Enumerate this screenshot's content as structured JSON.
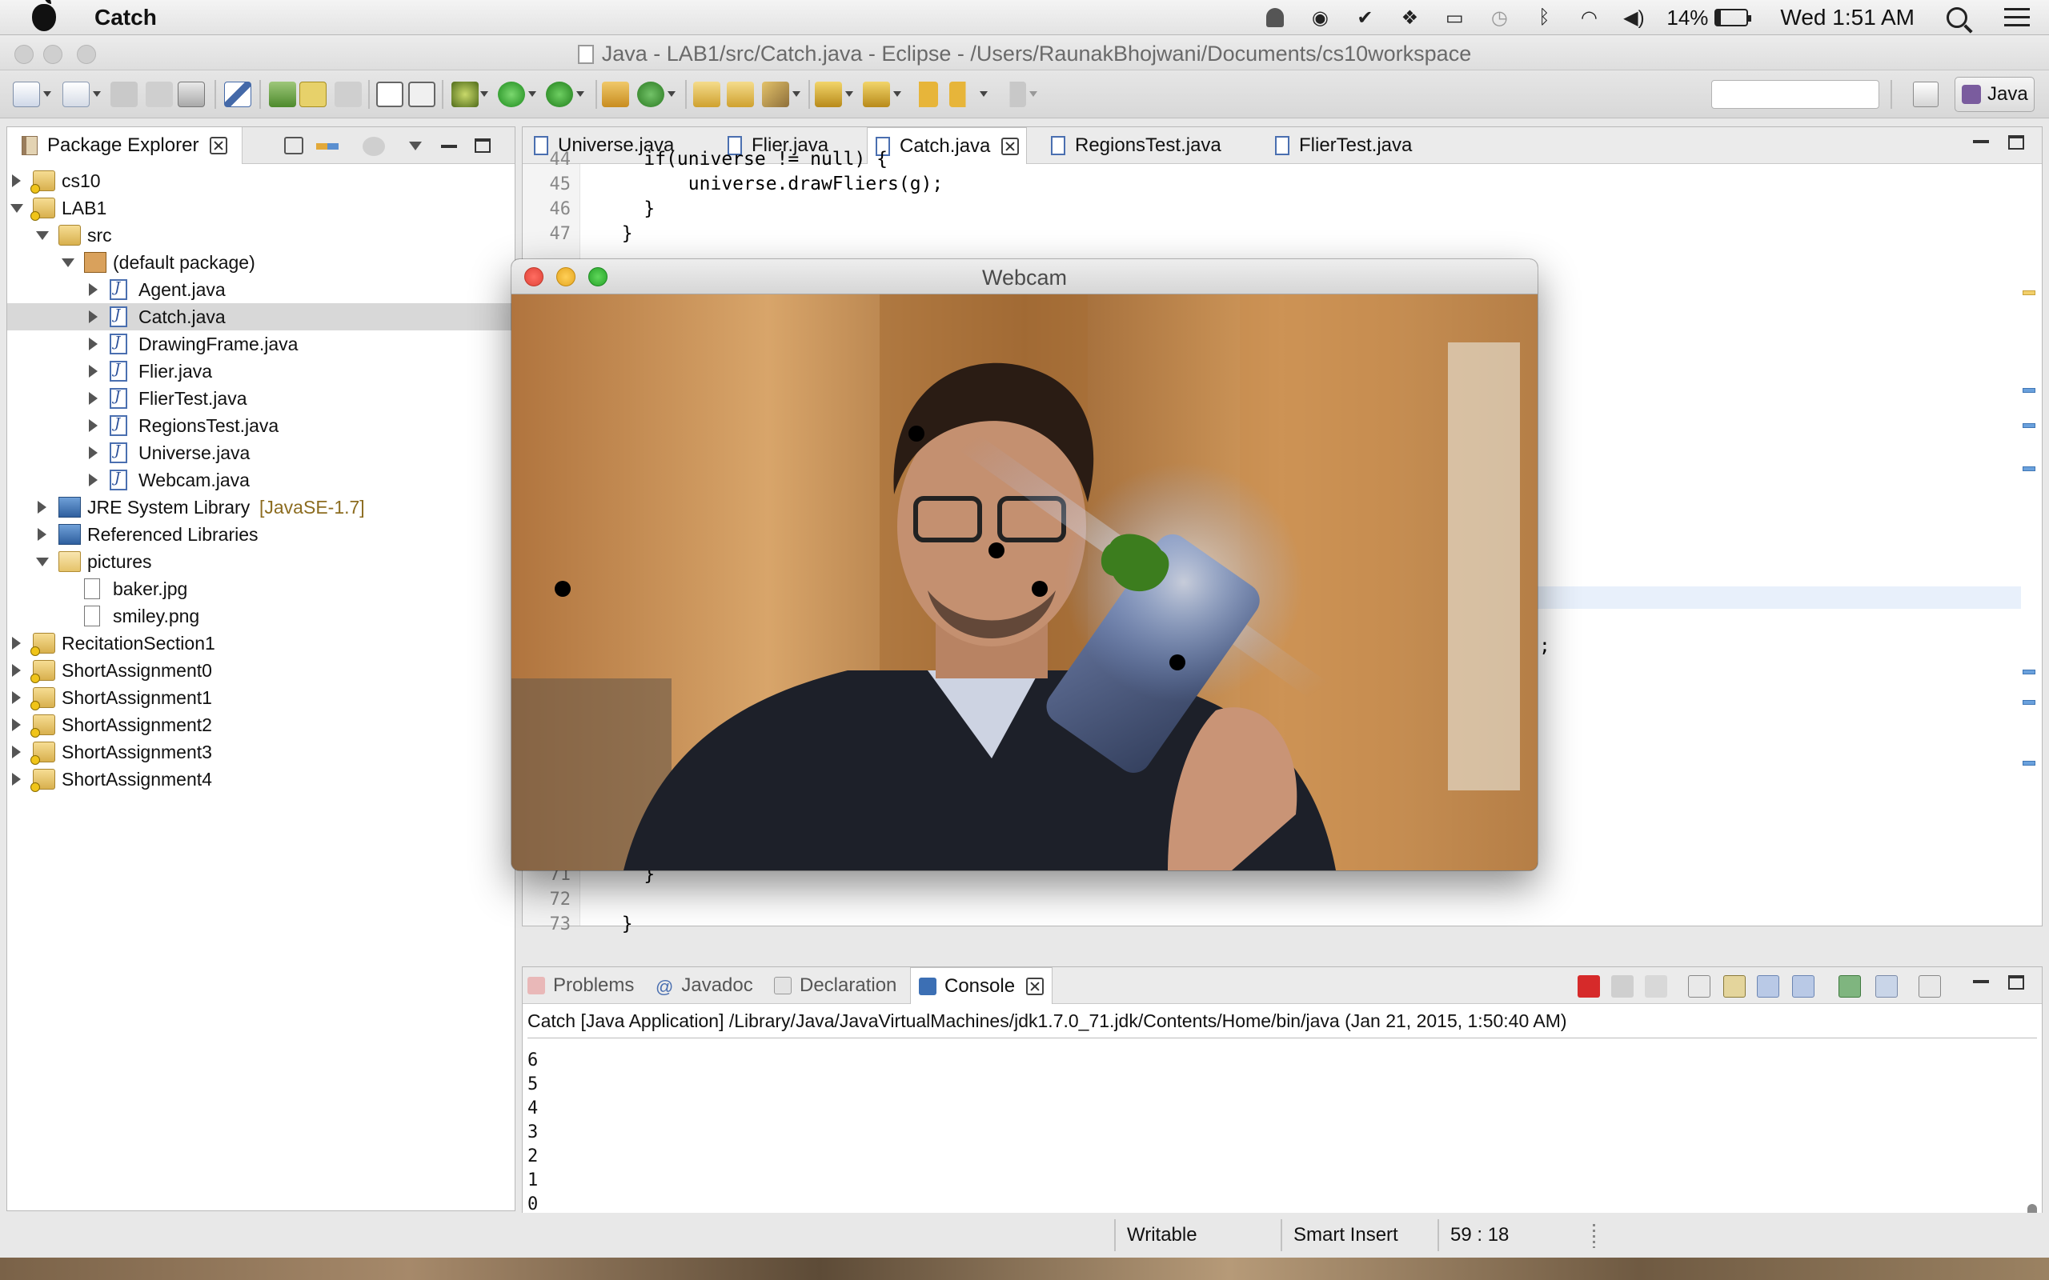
{
  "menubar": {
    "app_name": "Catch",
    "battery_percent": "14%",
    "clock": "Wed 1:51 AM",
    "icons": [
      "notification-icon",
      "user-icon",
      "check-icon",
      "dropbox-icon",
      "airplay-icon",
      "time-machine-icon",
      "bluetooth-icon",
      "wifi-icon",
      "volume-icon",
      "battery-icon",
      "spotlight-icon",
      "notification-center-icon"
    ],
    "battery_level": 0.14
  },
  "window": {
    "title": "Java - LAB1/src/Catch.java - Eclipse - /Users/RaunakBhojwani/Documents/cs10workspace"
  },
  "toolbar": {
    "quick_access_placeholder": "",
    "perspective_label": "Java"
  },
  "package_explorer": {
    "title": "Package Explorer",
    "tree": [
      {
        "label": "cs10",
        "level": 0,
        "expanded": false,
        "icon": "project-icon"
      },
      {
        "label": "LAB1",
        "level": 0,
        "expanded": true,
        "icon": "project-icon"
      },
      {
        "label": "src",
        "level": 1,
        "expanded": true,
        "icon": "source-folder-icon"
      },
      {
        "label": "(default package)",
        "level": 2,
        "expanded": true,
        "icon": "package-icon"
      },
      {
        "label": "Agent.java",
        "level": 3,
        "expanded": false,
        "icon": "java-file-icon"
      },
      {
        "label": "Catch.java",
        "level": 3,
        "expanded": false,
        "icon": "java-file-icon",
        "selected": true
      },
      {
        "label": "DrawingFrame.java",
        "level": 3,
        "expanded": false,
        "icon": "java-file-icon"
      },
      {
        "label": "Flier.java",
        "level": 3,
        "expanded": false,
        "icon": "java-file-icon"
      },
      {
        "label": "FlierTest.java",
        "level": 3,
        "expanded": false,
        "icon": "java-file-icon"
      },
      {
        "label": "RegionsTest.java",
        "level": 3,
        "expanded": false,
        "icon": "java-file-icon"
      },
      {
        "label": "Universe.java",
        "level": 3,
        "expanded": false,
        "icon": "java-file-icon"
      },
      {
        "label": "Webcam.java",
        "level": 3,
        "expanded": false,
        "icon": "java-file-icon"
      },
      {
        "label": "JRE System Library",
        "suffix": "[JavaSE-1.7]",
        "level": 1,
        "expanded": false,
        "icon": "library-icon"
      },
      {
        "label": "Referenced Libraries",
        "level": 1,
        "expanded": false,
        "icon": "library-icon"
      },
      {
        "label": "pictures",
        "level": 1,
        "expanded": true,
        "icon": "folder-icon"
      },
      {
        "label": "baker.jpg",
        "level": 2,
        "icon": "file-icon"
      },
      {
        "label": "smiley.png",
        "level": 2,
        "icon": "file-icon"
      },
      {
        "label": "RecitationSection1",
        "level": 0,
        "expanded": false,
        "icon": "project-icon"
      },
      {
        "label": "ShortAssignment0",
        "level": 0,
        "expanded": false,
        "icon": "project-icon"
      },
      {
        "label": "ShortAssignment1",
        "level": 0,
        "expanded": false,
        "icon": "project-icon"
      },
      {
        "label": "ShortAssignment2",
        "level": 0,
        "expanded": false,
        "icon": "project-icon"
      },
      {
        "label": "ShortAssignment3",
        "level": 0,
        "expanded": false,
        "icon": "project-icon"
      },
      {
        "label": "ShortAssignment4",
        "level": 0,
        "expanded": false,
        "icon": "project-icon"
      }
    ]
  },
  "editor": {
    "tabs": [
      {
        "label": "Universe.java",
        "active": false
      },
      {
        "label": "Flier.java",
        "active": false
      },
      {
        "label": "Catch.java",
        "active": true
      },
      {
        "label": "RegionsTest.java",
        "active": false
      },
      {
        "label": "FlierTest.java",
        "active": false
      }
    ],
    "top_lines": [
      {
        "num": "44",
        "code": "    if(universe != null) {"
      },
      {
        "num": "45",
        "code": "        universe.drawFliers(g);"
      },
      {
        "num": "46",
        "code": "    }"
      },
      {
        "num": "47",
        "code": "  }"
      }
    ],
    "bottom_lines": [
      {
        "num": "71",
        "code": "    }"
      },
      {
        "num": "72",
        "code": ""
      },
      {
        "num": "73",
        "code": "  }"
      }
    ],
    "visible_fragment": ";"
  },
  "webcam": {
    "title": "Webcam"
  },
  "console": {
    "tabs": [
      {
        "label": "Problems",
        "active": false
      },
      {
        "label": "Javadoc",
        "active": false
      },
      {
        "label": "Declaration",
        "active": false
      },
      {
        "label": "Console",
        "active": true
      }
    ],
    "header": "Catch [Java Application] /Library/Java/JavaVirtualMachines/jdk1.7.0_71.jdk/Contents/Home/bin/java (Jan 21, 2015, 1:50:40 AM)",
    "output": [
      "6",
      "5",
      "4",
      "3",
      "2",
      "1",
      "0"
    ]
  },
  "statusbar": {
    "writable": "Writable",
    "insert_mode": "Smart Insert",
    "position": "59 : 18"
  }
}
